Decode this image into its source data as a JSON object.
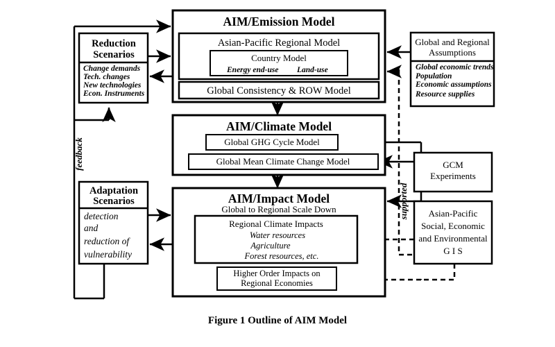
{
  "figure": {
    "caption": "Figure 1    Outline of  AIM Model"
  },
  "emission": {
    "title": "AIM/Emission Model",
    "regional": "Asian-Pacific Regional Model",
    "country": "Country Model",
    "country_left": "Energy end-use",
    "country_right": "Land-use",
    "consistency": "Global Consistency & ROW Model"
  },
  "climate": {
    "title": "AIM/Climate Model",
    "ghg": "Global GHG Cycle Model",
    "mean": "Global Mean Climate Change Model"
  },
  "impact": {
    "title": "AIM/Impact Model",
    "subtitle": "Global to Regional Scale Down",
    "regional_title": "Regional Climate Impacts",
    "regional_items": [
      "Water resources",
      "Agriculture",
      "Forest resources, etc."
    ],
    "higher_line1": "Higher Order Impacts on",
    "higher_line2": "Regional Economies"
  },
  "reduction": {
    "title_line1": "Reduction",
    "title_line2": "Scenarios",
    "items": [
      "Change demands",
      "Tech. changes",
      "New technologies",
      "Econ. Instruments"
    ]
  },
  "adaptation": {
    "title_line1": "Adaptation",
    "title_line2": "Scenarios",
    "items": [
      "detection",
      "and",
      "reduction of",
      "vulnerability"
    ]
  },
  "assumptions": {
    "title_line1": "Global and Regional",
    "title_line2": "Assumptions",
    "items": [
      "Global economic trends",
      "Population",
      "Economic assumptions",
      "Resource supplies"
    ]
  },
  "gcm": {
    "line1": "GCM",
    "line2": "Experiments"
  },
  "gis": {
    "line1": "Asian-Pacific",
    "line2": "Social, Economic",
    "line3": "and Environmental",
    "line4": "G I S"
  },
  "labels": {
    "feedback": "feedback",
    "supported": "supported"
  },
  "colors": {
    "background": "#ffffff",
    "stroke": "#000000",
    "text": "#000000"
  }
}
